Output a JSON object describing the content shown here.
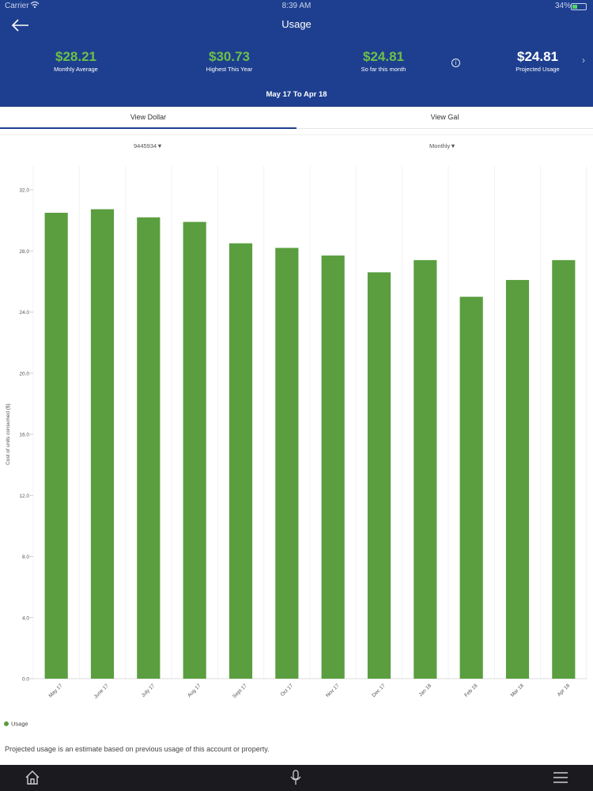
{
  "status_bar": {
    "carrier": "Carrier",
    "time": "8:39 AM",
    "battery": "34%"
  },
  "header": {
    "title": "Usage",
    "stats": [
      {
        "value": "$28.21",
        "label": "Monthly Average"
      },
      {
        "value": "$30.73",
        "label": "Highest This Year"
      },
      {
        "value": "$24.81",
        "label": "So far this month"
      },
      {
        "value": "$24.81",
        "label": "Projected Usage"
      }
    ],
    "date_range": "May 17 To Apr 18"
  },
  "tabs": [
    {
      "label": "View Dollar",
      "active": true
    },
    {
      "label": "View Gal",
      "active": false
    }
  ],
  "filters": {
    "account": "9445934▼",
    "period": "Monthly▼"
  },
  "colors": {
    "header_bg": "#1e3f8f",
    "accent_green": "#6cc04a",
    "bar_green": "#5a9e3f"
  },
  "chart_data": {
    "type": "bar",
    "categories": [
      "May 17",
      "June 17",
      "July 17",
      "Aug 17",
      "Sept 17",
      "Oct 17",
      "Nov 17",
      "Dec 17",
      "Jan 18",
      "Feb 18",
      "Mar 18",
      "Apr 18"
    ],
    "series": [
      {
        "name": "Usage",
        "values": [
          30.5,
          30.73,
          30.2,
          29.9,
          28.5,
          28.2,
          27.7,
          26.6,
          27.4,
          25.0,
          26.1,
          27.4
        ]
      }
    ],
    "ylabel": "Cost of units consumed ($)",
    "yticks": [
      "0.0",
      "4.0",
      "8.0",
      "12.0",
      "16.0",
      "20.0",
      "24.0",
      "28.0",
      "32.0"
    ],
    "ylim": [
      0,
      32
    ],
    "grid": true,
    "legend": "bottom-left"
  },
  "footer_note": "Projected usage is an estimate based on previous usage of this account or property.",
  "bottom_bar": [
    "home-icon",
    "microphone-icon",
    "menu-icon"
  ]
}
